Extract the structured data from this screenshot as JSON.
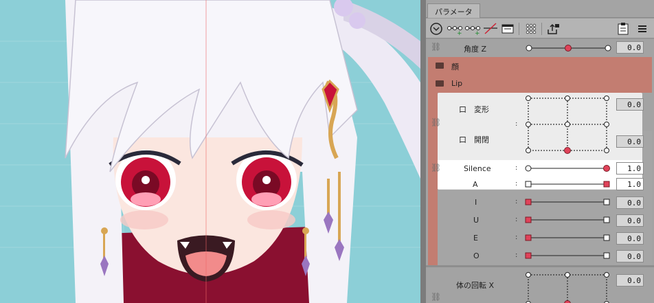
{
  "panel": {
    "tab_title": "パラメータ",
    "menu_icon": "hamburger-menu-icon"
  },
  "toolbar": {
    "icons": [
      "circle-chevron-down-icon",
      "add-keyform-icon",
      "add-keyform-multi-icon",
      "remove-keyform-icon",
      "film-strip-icon",
      "dot-grid-icon",
      "export-lock-icon",
      "clipboard-icon"
    ]
  },
  "params": {
    "angle_z": {
      "label": "角度 Z",
      "value": "0.0",
      "knob": 0.5
    },
    "group_face": {
      "label": "顔"
    },
    "group_lip": {
      "label": "Lip"
    },
    "deform": {
      "label": "口　変形",
      "value": "0.0"
    },
    "open": {
      "label": "口　開閉",
      "value": "0.0"
    },
    "silence": {
      "label": "Silence",
      "value": "1.0",
      "knob": 1.0
    },
    "a": {
      "label": "A",
      "value": "1.0",
      "knob": 1.0
    },
    "i": {
      "label": "I",
      "value": "0.0",
      "knob": 0.0
    },
    "u": {
      "label": "U",
      "value": "0.0",
      "knob": 0.0
    },
    "e": {
      "label": "E",
      "value": "0.0",
      "knob": 0.0
    },
    "o": {
      "label": "O",
      "value": "0.0",
      "knob": 0.0
    },
    "body_x": {
      "label": "体の回転 X",
      "value": "0.0"
    }
  },
  "colors": {
    "accent_red": "#e0435a",
    "group_bg": "#c37d71",
    "canvas_bg": "#8ccfd7"
  }
}
